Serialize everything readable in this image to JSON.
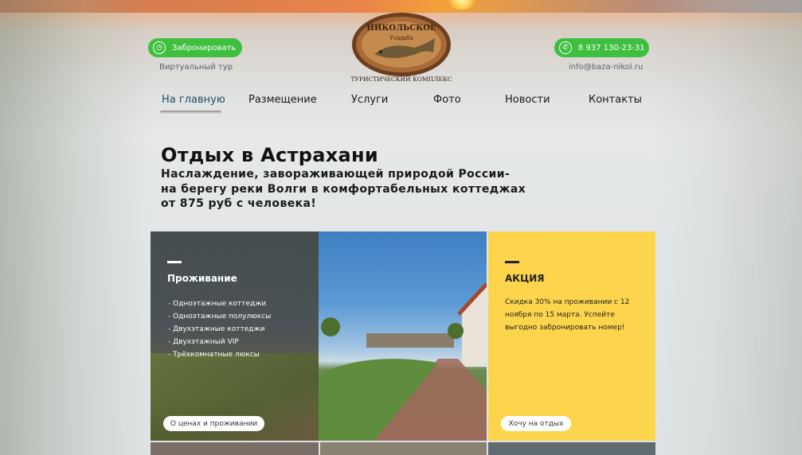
{
  "header": {
    "book_button": {
      "label": "Забронировать",
      "icon": "clock-icon"
    },
    "virtual_tour": "Виртуальный тур",
    "phone_button": {
      "label": "8 937 130-23-31",
      "icon": "phone-icon"
    },
    "email": "info@baza-nikol.ru",
    "logo": {
      "line1": "НИКОЛЬСКОЕ",
      "line2": "Усадьба",
      "line3": "ТУРИСТИЧЕСКИЙ КОМПЛЕКС"
    }
  },
  "nav": {
    "items": [
      {
        "label": "На главную",
        "active": true
      },
      {
        "label": "Размещение"
      },
      {
        "label": "Услуги"
      },
      {
        "label": "Фото"
      },
      {
        "label": "Новости"
      },
      {
        "label": "Контакты"
      }
    ]
  },
  "hero": {
    "title": "Отдых в Астрахани",
    "line1": "Наслаждение, завораживающей природой России-",
    "line2": "на берегу реки Волги в комфортабельных коттеджах",
    "line3": "от 875 руб с человека!"
  },
  "cards": {
    "accommodation": {
      "title": "Проживание",
      "items": [
        "Одноэтажные коттеджи",
        "Одноэтажные полулюксы",
        "Двухэтажные коттеджи",
        "Двухэтажный VIP",
        "Трёхкомнатные люксы"
      ],
      "button": "О ценах и проживании"
    },
    "promo": {
      "title": "АКЦИЯ",
      "text": "Скидка 30% на проживании с 12 ноября по 15 марта. Успейте выгодно забронировать номер!",
      "button": "Хочу на отдых",
      "bg_color": "#fdd54d"
    }
  },
  "colors": {
    "accent_green": "#3fbf3f",
    "promo_yellow": "#fdd54d"
  }
}
